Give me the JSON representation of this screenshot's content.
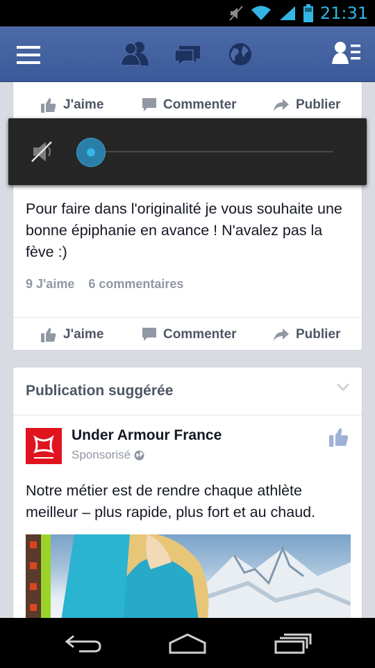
{
  "status_bar": {
    "time": "21:31",
    "icons": [
      "muted-icon",
      "wifi-icon",
      "signal-icon",
      "battery-icon"
    ]
  },
  "header": {
    "icons": [
      "menu-icon",
      "friend-requests-icon",
      "messages-icon",
      "notifications-globe-icon",
      "contacts-icon"
    ]
  },
  "actions": {
    "like": "J'aime",
    "comment": "Commenter",
    "share": "Publier"
  },
  "post": {
    "text": "Pour faire dans l'originalité je vous souhaite une bonne épiphanie en avance ! N'avalez pas la fève :)",
    "likes": "9 J'aime",
    "comments": "6 commentaires"
  },
  "suggested": {
    "title": "Publication suggérée",
    "page_name": "Under Armour France",
    "sponsored": "Sponsorisé",
    "text": "Notre métier est de rendre chaque athlète meilleur – plus rapide, plus fort et au chaud."
  },
  "volume": {
    "level": 0
  },
  "colors": {
    "fb_blue": "#3b5998",
    "accent": "#33b5e5",
    "brand_red": "#e0141e"
  },
  "navbar": {
    "icons": [
      "back-icon",
      "home-icon",
      "recent-apps-icon"
    ]
  }
}
